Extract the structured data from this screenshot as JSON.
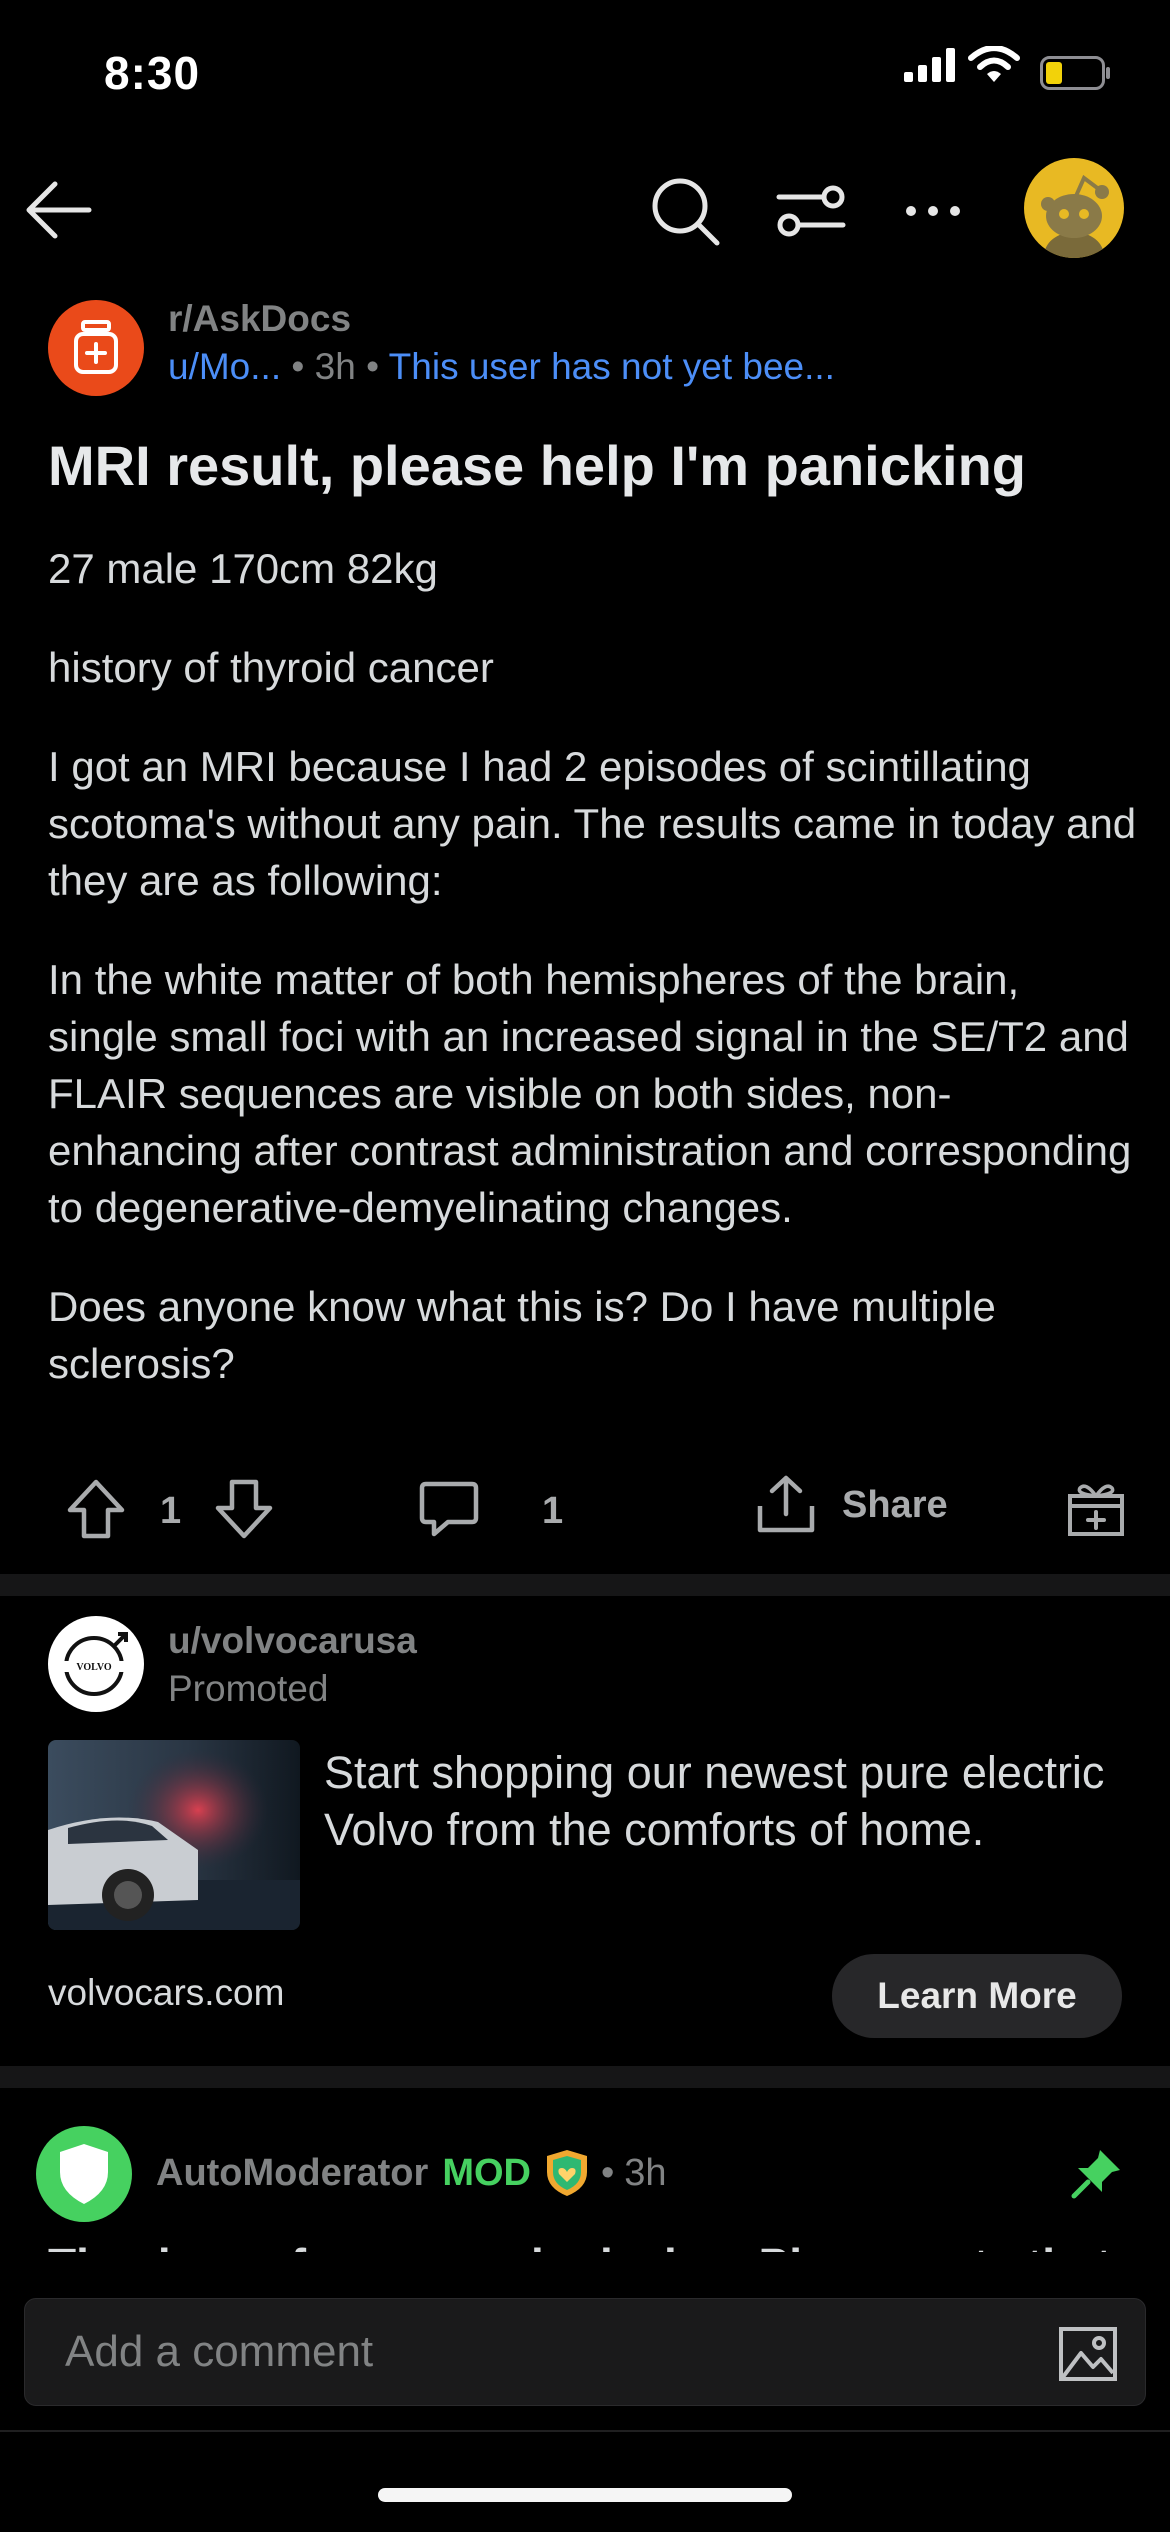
{
  "status_bar": {
    "time": "8:30"
  },
  "subreddit": {
    "name": "r/AskDocs"
  },
  "post": {
    "author": "u/Mo...",
    "separator": "•",
    "age": "3h",
    "flair": "This user has not yet bee...",
    "title": "MRI result, please help I'm panicking",
    "body": [
      "27 male 170cm 82kg",
      "history of thyroid cancer",
      "I got an MRI because I had 2 episodes of scintillating scotoma's without any pain. The results came in today and they are as following:",
      "In the white matter of both hemispheres of the brain, single small foci with an increased signal in the SE/T2 and FLAIR sequences are visible on both sides, non-enhancing after contrast administration and corresponding to degenerative-demyelinating changes.",
      "Does anyone know what this is? Do I have multiple sclerosis?"
    ],
    "votes": "1",
    "comment_count": "1",
    "share_label": "Share"
  },
  "promoted": {
    "user": "u/volvocarusa",
    "label": "Promoted",
    "logo_text": "VOLVO",
    "text": "Start shopping our newest pure electric Volvo from the comforts of home.",
    "domain": "volvocars.com",
    "cta": "Learn More"
  },
  "comment": {
    "author": "AutoModerator",
    "mod_label": "MOD",
    "separator": "•",
    "age": "3h",
    "preview": "Thank you for your submission. Please note that"
  },
  "composer": {
    "placeholder": "Add a comment"
  },
  "colors": {
    "background": "#000000",
    "subreddit_icon": "#ea4a1a",
    "link_blue": "#4c8ef7",
    "mod_green": "#46d160",
    "avatar_yellow": "#e8b923"
  },
  "icons": [
    "back-arrow-icon",
    "search-icon",
    "filter-icon",
    "more-icon",
    "upvote-icon",
    "downvote-icon",
    "comment-icon",
    "share-icon",
    "award-icon",
    "pin-icon",
    "image-icon",
    "shield-icon"
  ]
}
